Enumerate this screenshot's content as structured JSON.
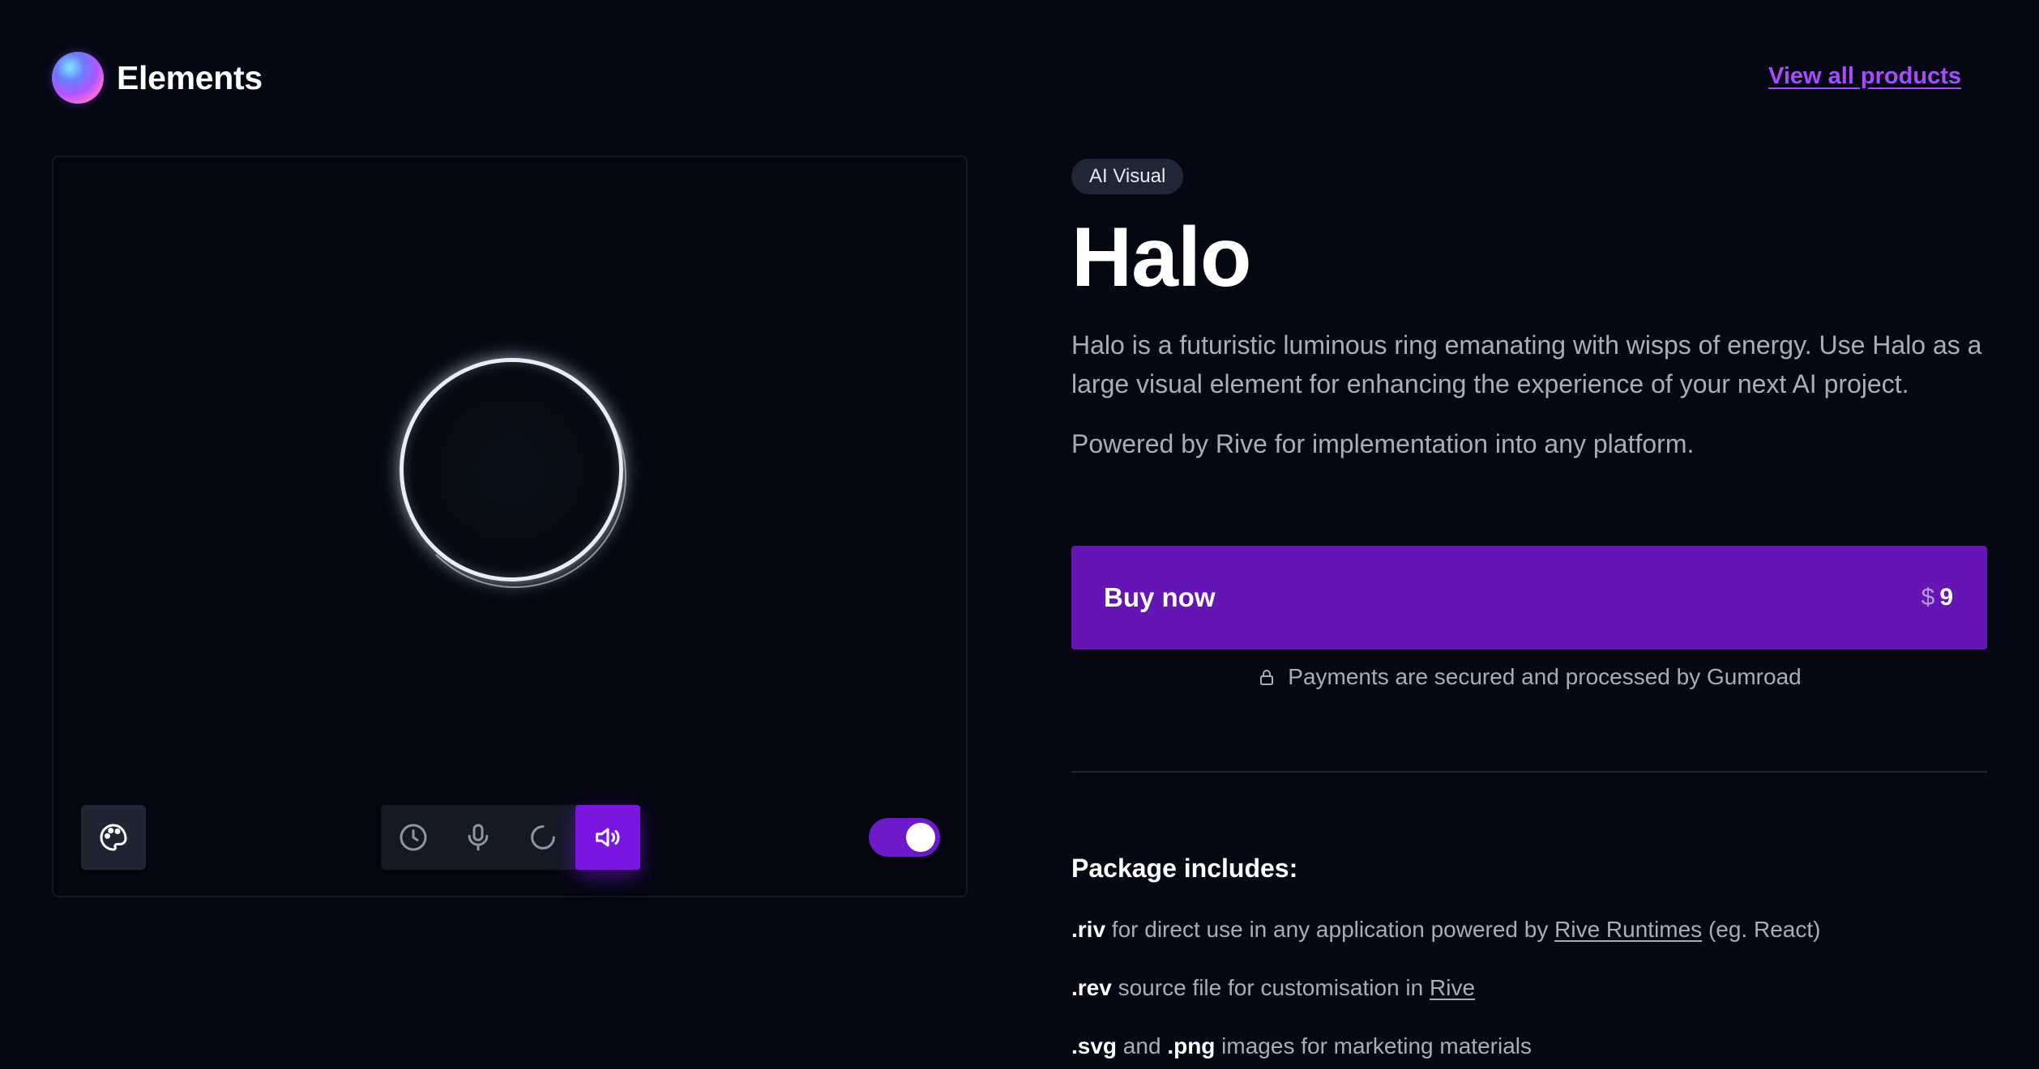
{
  "header": {
    "brand_name": "Elements",
    "view_all_label": "View all products"
  },
  "preview": {
    "mode_buttons": [
      "clock-icon",
      "microphone-icon",
      "loading-icon",
      "speaker-icon"
    ],
    "active_mode": "speaker-icon",
    "toggle_on": true
  },
  "product": {
    "badge": "AI Visual",
    "title": "Halo",
    "description": "Halo is a futuristic luminous ring emanating with wisps of energy. Use Halo as a large visual element for enhancing the experience of your next AI project.",
    "powered_by": "Powered by Rive for implementation into any platform.",
    "buy_label": "Buy now",
    "price_currency": "$",
    "price_value": "9",
    "secure_text": "Payments are secured and processed by Gumroad"
  },
  "package": {
    "heading": "Package includes:",
    "items": [
      {
        "ext": ".riv",
        "text_before": " for direct use in any application powered by ",
        "link": "Rive Runtimes",
        "text_after": " (eg. React)"
      },
      {
        "ext": ".rev",
        "text_before": " source file for customisation in ",
        "link": "Rive",
        "text_after": ""
      },
      {
        "ext": ".svg",
        "text_before": " and ",
        "ext2": ".png",
        "text_after": " images for marketing materials"
      }
    ]
  },
  "colors": {
    "background": "#050813",
    "accent_purple": "#6415b3",
    "link_purple": "#a64dff",
    "toggle_purple": "#6d18c9"
  }
}
